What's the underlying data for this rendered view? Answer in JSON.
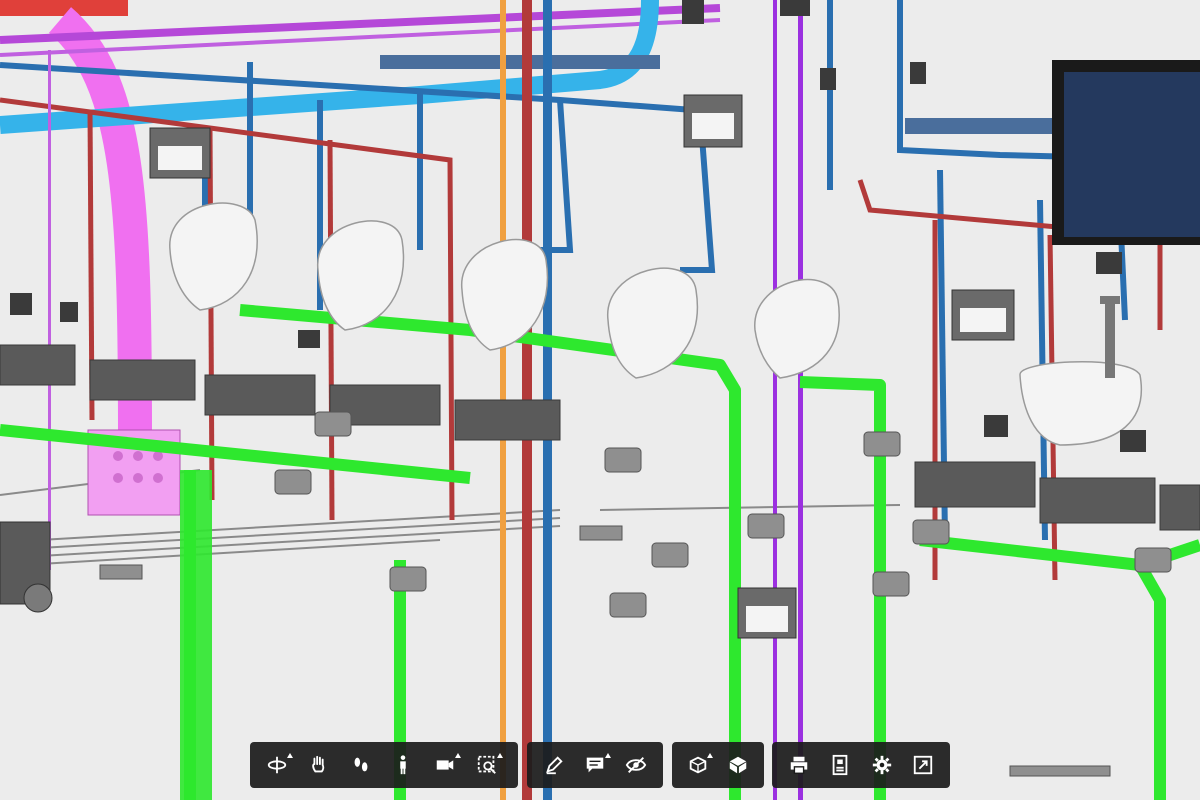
{
  "app": {
    "view": "3D model viewer"
  },
  "colors": {
    "background": "#ececec",
    "toolbar_bg": "#1c1c1c",
    "toolbar_icon": "#ffffff",
    "pipe_green": "#2ee82e",
    "pipe_blue": "#2a6fb0",
    "pipe_red": "#b23a3a",
    "duct_cyan": "#35b3ea",
    "duct_magenta": "#f070f0",
    "pipe_purple": "#9b30e0",
    "pipe_orange": "#f0a040",
    "fixture_gray": "#5a5a5a",
    "screen_navy": "#24395e"
  },
  "toolbar": {
    "groups": [
      {
        "name": "navigation",
        "tools": [
          {
            "id": "orbit",
            "icon": "orbit-icon",
            "has_menu": true
          },
          {
            "id": "pan",
            "icon": "pan-hand-icon",
            "has_menu": false
          },
          {
            "id": "walk",
            "icon": "footprints-icon",
            "has_menu": false
          },
          {
            "id": "first-person",
            "icon": "person-icon",
            "has_menu": false
          },
          {
            "id": "camera",
            "icon": "camera-icon",
            "has_menu": true
          },
          {
            "id": "fit-to-view",
            "icon": "zoom-fit-icon",
            "has_menu": true
          }
        ]
      },
      {
        "name": "markup",
        "tools": [
          {
            "id": "measure",
            "icon": "pencil-icon",
            "has_menu": false
          },
          {
            "id": "comments",
            "icon": "comment-icon",
            "has_menu": true
          },
          {
            "id": "hide",
            "icon": "eye-hidden-icon",
            "has_menu": false
          }
        ]
      },
      {
        "name": "model",
        "tools": [
          {
            "id": "section",
            "icon": "section-box-icon",
            "has_menu": true
          },
          {
            "id": "model-browser",
            "icon": "cube-icon",
            "has_menu": false
          }
        ]
      },
      {
        "name": "settings",
        "tools": [
          {
            "id": "print",
            "icon": "print-icon",
            "has_menu": false
          },
          {
            "id": "properties",
            "icon": "properties-icon",
            "has_menu": false
          },
          {
            "id": "settings",
            "icon": "gear-icon",
            "has_menu": false
          },
          {
            "id": "fullscreen",
            "icon": "fullscreen-icon",
            "has_menu": false
          }
        ]
      }
    ]
  }
}
